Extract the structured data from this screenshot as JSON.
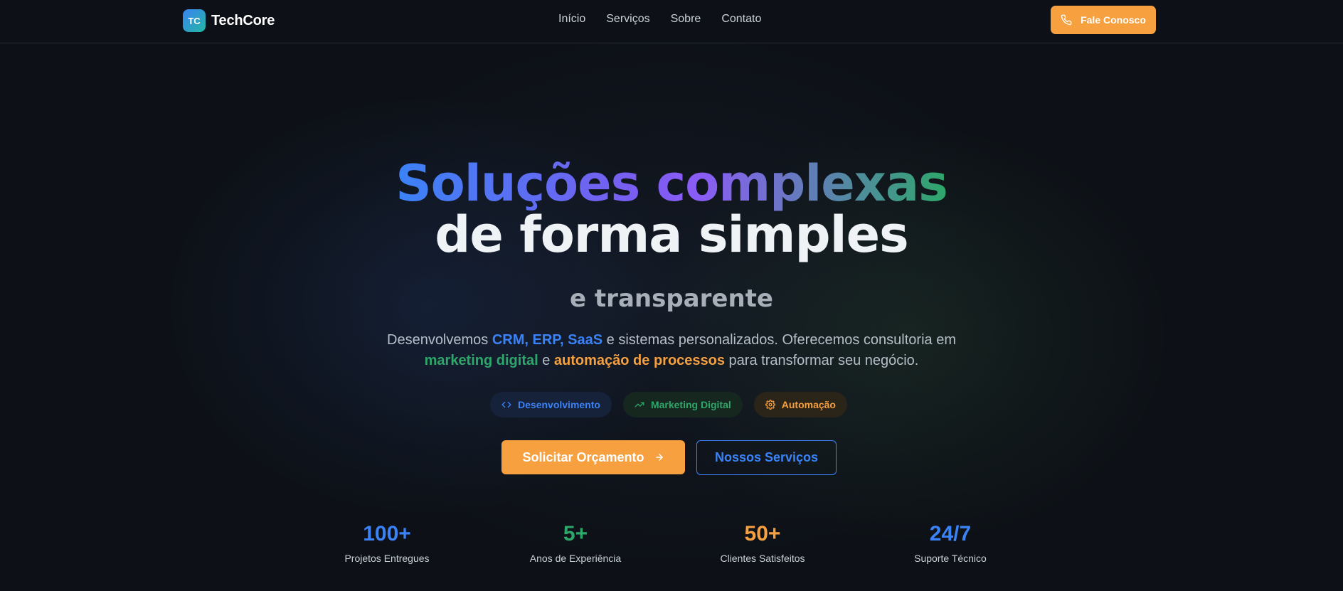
{
  "nav": {
    "logo_initials": "TC",
    "brand": "TechCore",
    "links": [
      "Início",
      "Serviços",
      "Sobre",
      "Contato"
    ],
    "cta_label": "Fale Conosco",
    "cta_icon": "phone-icon"
  },
  "hero": {
    "title_line1": "Soluções complexas",
    "title_line2": "de forma simples",
    "subtitle": "e transparente",
    "desc": {
      "p1": "Desenvolvemos ",
      "hl1": "CRM, ERP, SaaS",
      "p2": " e sistemas personalizados. Oferecemos consultoria em ",
      "hl2": "marketing digital",
      "p3": " e ",
      "hl3": "automação de processos",
      "p4": " para transformar seu negócio."
    },
    "pills": [
      {
        "label": "Desenvolvimento",
        "icon": "code-icon"
      },
      {
        "label": "Marketing Digital",
        "icon": "trending-up-icon"
      },
      {
        "label": "Automação",
        "icon": "gear-icon"
      }
    ],
    "primary_button": "Solicitar Orçamento",
    "secondary_button": "Nossos Serviços"
  },
  "stats": [
    {
      "value": "100+",
      "label": "Projetos Entregues",
      "color": "#3b82f6"
    },
    {
      "value": "5+",
      "label": "Anos de Experiência",
      "color": "#2ea76a"
    },
    {
      "value": "50+",
      "label": "Clientes Satisfeitos",
      "color": "#f6a040"
    },
    {
      "value": "24/7",
      "label": "Suporte Técnico",
      "color": "#3b82f6"
    }
  ],
  "colors": {
    "background": "#0d1117",
    "accent_orange": "#f6a040",
    "accent_blue": "#3b82f6",
    "accent_green": "#2ea76a",
    "accent_purple": "#8b5cf6"
  }
}
